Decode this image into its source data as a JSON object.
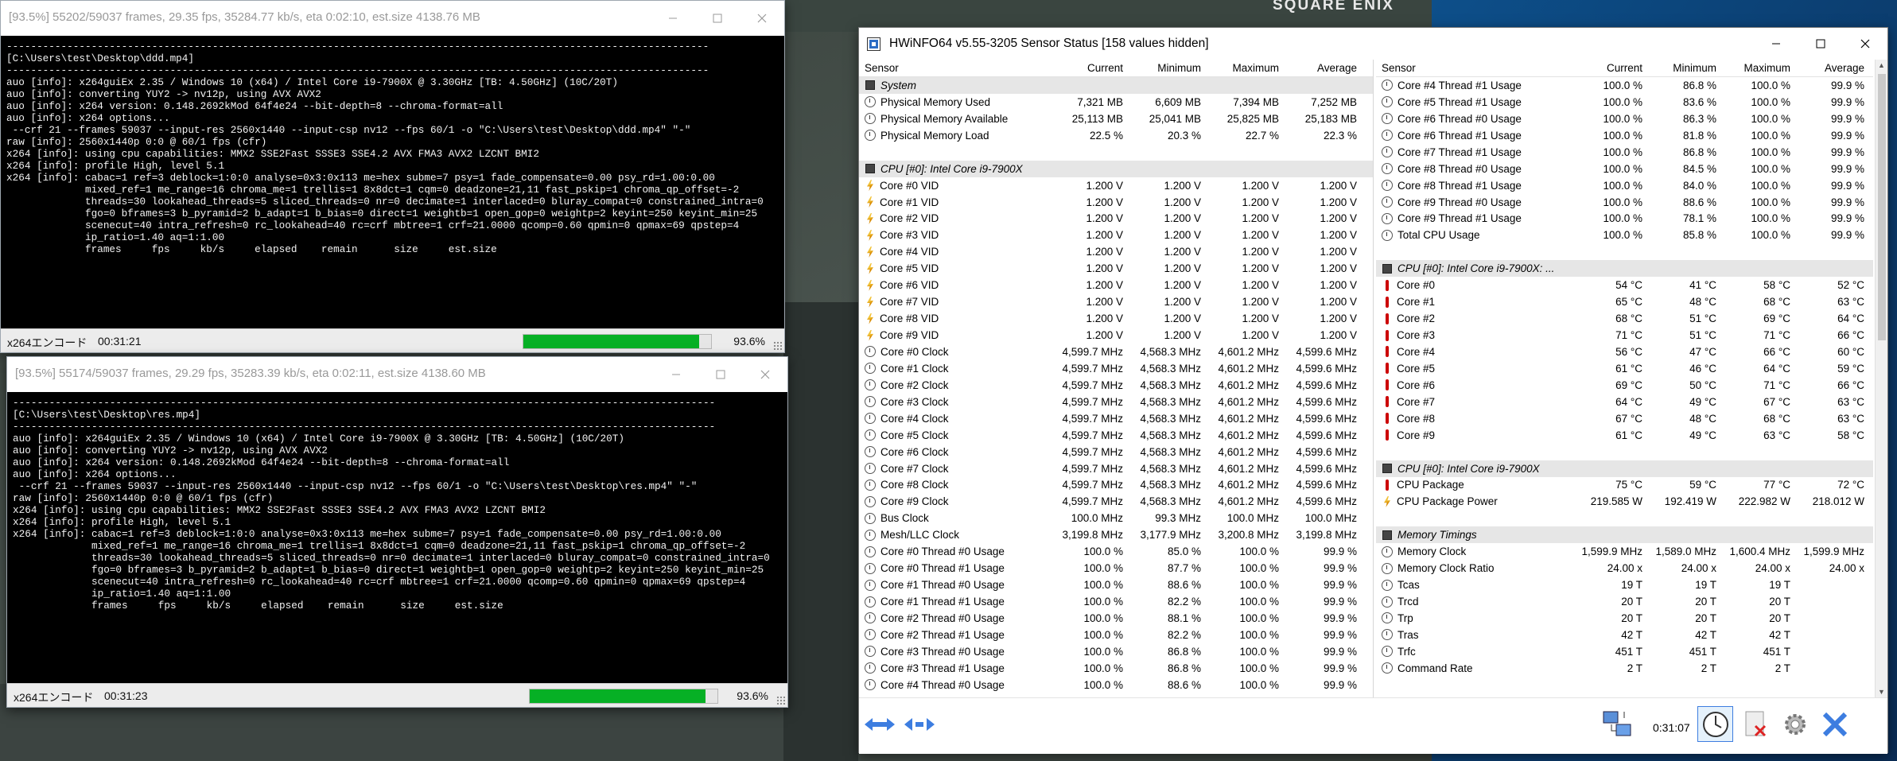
{
  "colors": {
    "accent_blue": "#3d7de0",
    "progress_green": "#06b025",
    "console_bg": "#000000",
    "thermo_red": "#cc0000"
  },
  "backdrop": {
    "brand_text": "SQUARE ENIX"
  },
  "encoder1": {
    "title": "[93.5%] 55202/59037 frames, 29.35 fps, 35284.77 kb/s, eta 0:02:10, est.size 4138.76 MB",
    "console_lines": [
      "--------------------------------------------------------------------------------------------------------------------",
      "[C:\\Users\\test\\Desktop\\ddd.mp4]",
      "--------------------------------------------------------------------------------------------------------------------",
      "auo [info]: x264guiEx 2.35 / Windows 10 (x64) / Intel Core i9-7900X @ 3.30GHz [TB: 4.50GHz] (10C/20T)",
      "auo [info]: converting YUY2 -> nv12p, using AVX AVX2",
      "auo [info]: x264 version: 0.148.2692kMod 64f4e24 --bit-depth=8 --chroma-format=all",
      "auo [info]: x264 options...",
      " --crf 21 --frames 59037 --input-res 2560x1440 --input-csp nv12 --fps 60/1 -o \"C:\\Users\\test\\Desktop\\ddd.mp4\" \"-\"",
      "raw [info]: 2560x1440p 0:0 @ 60/1 fps (cfr)",
      "x264 [info]: using cpu capabilities: MMX2 SSE2Fast SSSE3 SSE4.2 AVX FMA3 AVX2 LZCNT BMI2",
      "x264 [info]: profile High, level 5.1",
      "x264 [info]: cabac=1 ref=3 deblock=1:0:0 analyse=0x3:0x113 me=hex subme=7 psy=1 fade_compensate=0.00 psy_rd=1.00:0.00",
      "             mixed_ref=1 me_range=16 chroma_me=1 trellis=1 8x8dct=1 cqm=0 deadzone=21,11 fast_pskip=1 chroma_qp_offset=-2",
      "             threads=30 lookahead_threads=5 sliced_threads=0 nr=0 decimate=1 interlaced=0 bluray_compat=0 constrained_intra=0",
      "             fgo=0 bframes=3 b_pyramid=2 b_adapt=1 b_bias=0 direct=1 weightb=1 open_gop=0 weightp=2 keyint=250 keyint_min=25",
      "             scenecut=40 intra_refresh=0 rc_lookahead=40 rc=crf mbtree=1 crf=21.0000 qcomp=0.60 qpmin=0 qpmax=69 qpstep=4",
      "             ip_ratio=1.40 aq=1:1.00",
      "             frames     fps     kb/s     elapsed    remain      size     est.size"
    ],
    "status_tag": "x264エンコード",
    "elapsed": "00:31:21",
    "progress": 0.936,
    "percent": "93.6%"
  },
  "encoder2": {
    "title": "[93.5%] 55174/59037 frames, 29.29 fps, 35283.39 kb/s, eta 0:02:11, est.size 4138.60 MB",
    "console_lines": [
      "--------------------------------------------------------------------------------------------------------------------",
      "[C:\\Users\\test\\Desktop\\res.mp4]",
      "--------------------------------------------------------------------------------------------------------------------",
      "auo [info]: x264guiEx 2.35 / Windows 10 (x64) / Intel Core i9-7900X @ 3.30GHz [TB: 4.50GHz] (10C/20T)",
      "auo [info]: converting YUY2 -> nv12p, using AVX AVX2",
      "auo [info]: x264 version: 0.148.2692kMod 64f4e24 --bit-depth=8 --chroma-format=all",
      "auo [info]: x264 options...",
      " --crf 21 --frames 59037 --input-res 2560x1440 --input-csp nv12 --fps 60/1 -o \"C:\\Users\\test\\Desktop\\res.mp4\" \"-\"",
      "raw [info]: 2560x1440p 0:0 @ 60/1 fps (cfr)",
      "x264 [info]: using cpu capabilities: MMX2 SSE2Fast SSSE3 SSE4.2 AVX FMA3 AVX2 LZCNT BMI2",
      "x264 [info]: profile High, level 5.1",
      "x264 [info]: cabac=1 ref=3 deblock=1:0:0 analyse=0x3:0x113 me=hex subme=7 psy=1 fade_compensate=0.00 psy_rd=1.00:0.00",
      "             mixed_ref=1 me_range=16 chroma_me=1 trellis=1 8x8dct=1 cqm=0 deadzone=21,11 fast_pskip=1 chroma_qp_offset=-2",
      "             threads=30 lookahead_threads=5 sliced_threads=0 nr=0 decimate=1 interlaced=0 bluray_compat=0 constrained_intra=0",
      "             fgo=0 bframes=3 b_pyramid=2 b_adapt=1 b_bias=0 direct=1 weightb=1 open_gop=0 weightp=2 keyint=250 keyint_min=25",
      "             scenecut=40 intra_refresh=0 rc_lookahead=40 rc=crf mbtree=1 crf=21.0000 qcomp=0.60 qpmin=0 qpmax=69 qpstep=4",
      "             ip_ratio=1.40 aq=1:1.00",
      "             frames     fps     kb/s     elapsed    remain      size     est.size"
    ],
    "status_tag": "x264エンコード",
    "elapsed": "00:31:23",
    "progress": 0.936,
    "percent": "93.6%"
  },
  "hwinfo": {
    "title": "HWiNFO64 v5.55-3205 Sensor Status [158 values hidden]",
    "columns": [
      "Sensor",
      "Current",
      "Minimum",
      "Maximum",
      "Average"
    ],
    "left_rows": [
      {
        "kind": "cat",
        "label": "System"
      },
      {
        "kind": "clock",
        "label": "Physical Memory Used",
        "v": [
          "7,321 MB",
          "6,609 MB",
          "7,394 MB",
          "7,252 MB"
        ]
      },
      {
        "kind": "clock",
        "label": "Physical Memory Available",
        "v": [
          "25,113 MB",
          "25,041 MB",
          "25,825 MB",
          "25,183 MB"
        ]
      },
      {
        "kind": "clock",
        "label": "Physical Memory Load",
        "v": [
          "22.5 %",
          "20.3 %",
          "22.7 %",
          "22.3 %"
        ]
      },
      {
        "kind": "blank"
      },
      {
        "kind": "cat",
        "label": "CPU [#0]: Intel Core i9-7900X"
      },
      {
        "kind": "bolt",
        "label": "Core #0 VID",
        "v": [
          "1.200 V",
          "1.200 V",
          "1.200 V",
          "1.200 V"
        ]
      },
      {
        "kind": "bolt",
        "label": "Core #1 VID",
        "v": [
          "1.200 V",
          "1.200 V",
          "1.200 V",
          "1.200 V"
        ]
      },
      {
        "kind": "bolt",
        "label": "Core #2 VID",
        "v": [
          "1.200 V",
          "1.200 V",
          "1.200 V",
          "1.200 V"
        ]
      },
      {
        "kind": "bolt",
        "label": "Core #3 VID",
        "v": [
          "1.200 V",
          "1.200 V",
          "1.200 V",
          "1.200 V"
        ]
      },
      {
        "kind": "bolt",
        "label": "Core #4 VID",
        "v": [
          "1.200 V",
          "1.200 V",
          "1.200 V",
          "1.200 V"
        ]
      },
      {
        "kind": "bolt",
        "label": "Core #5 VID",
        "v": [
          "1.200 V",
          "1.200 V",
          "1.200 V",
          "1.200 V"
        ]
      },
      {
        "kind": "bolt",
        "label": "Core #6 VID",
        "v": [
          "1.200 V",
          "1.200 V",
          "1.200 V",
          "1.200 V"
        ]
      },
      {
        "kind": "bolt",
        "label": "Core #7 VID",
        "v": [
          "1.200 V",
          "1.200 V",
          "1.200 V",
          "1.200 V"
        ]
      },
      {
        "kind": "bolt",
        "label": "Core #8 VID",
        "v": [
          "1.200 V",
          "1.200 V",
          "1.200 V",
          "1.200 V"
        ]
      },
      {
        "kind": "bolt",
        "label": "Core #9 VID",
        "v": [
          "1.200 V",
          "1.200 V",
          "1.200 V",
          "1.200 V"
        ]
      },
      {
        "kind": "clock",
        "label": "Core #0 Clock",
        "v": [
          "4,599.7 MHz",
          "4,568.3 MHz",
          "4,601.2 MHz",
          "4,599.6 MHz"
        ]
      },
      {
        "kind": "clock",
        "label": "Core #1 Clock",
        "v": [
          "4,599.7 MHz",
          "4,568.3 MHz",
          "4,601.2 MHz",
          "4,599.6 MHz"
        ]
      },
      {
        "kind": "clock",
        "label": "Core #2 Clock",
        "v": [
          "4,599.7 MHz",
          "4,568.3 MHz",
          "4,601.2 MHz",
          "4,599.6 MHz"
        ]
      },
      {
        "kind": "clock",
        "label": "Core #3 Clock",
        "v": [
          "4,599.7 MHz",
          "4,568.3 MHz",
          "4,601.2 MHz",
          "4,599.6 MHz"
        ]
      },
      {
        "kind": "clock",
        "label": "Core #4 Clock",
        "v": [
          "4,599.7 MHz",
          "4,568.3 MHz",
          "4,601.2 MHz",
          "4,599.6 MHz"
        ]
      },
      {
        "kind": "clock",
        "label": "Core #5 Clock",
        "v": [
          "4,599.7 MHz",
          "4,568.3 MHz",
          "4,601.2 MHz",
          "4,599.6 MHz"
        ]
      },
      {
        "kind": "clock",
        "label": "Core #6 Clock",
        "v": [
          "4,599.7 MHz",
          "4,568.3 MHz",
          "4,601.2 MHz",
          "4,599.6 MHz"
        ]
      },
      {
        "kind": "clock",
        "label": "Core #7 Clock",
        "v": [
          "4,599.7 MHz",
          "4,568.3 MHz",
          "4,601.2 MHz",
          "4,599.6 MHz"
        ]
      },
      {
        "kind": "clock",
        "label": "Core #8 Clock",
        "v": [
          "4,599.7 MHz",
          "4,568.3 MHz",
          "4,601.2 MHz",
          "4,599.6 MHz"
        ]
      },
      {
        "kind": "clock",
        "label": "Core #9 Clock",
        "v": [
          "4,599.7 MHz",
          "4,568.3 MHz",
          "4,601.2 MHz",
          "4,599.6 MHz"
        ]
      },
      {
        "kind": "clock",
        "label": "Bus Clock",
        "v": [
          "100.0 MHz",
          "99.3 MHz",
          "100.0 MHz",
          "100.0 MHz"
        ]
      },
      {
        "kind": "clock",
        "label": "Mesh/LLC Clock",
        "v": [
          "3,199.8 MHz",
          "3,177.9 MHz",
          "3,200.8 MHz",
          "3,199.8 MHz"
        ]
      },
      {
        "kind": "clock",
        "label": "Core #0 Thread #0 Usage",
        "v": [
          "100.0 %",
          "85.0 %",
          "100.0 %",
          "99.9 %"
        ]
      },
      {
        "kind": "clock",
        "label": "Core #0 Thread #1 Usage",
        "v": [
          "100.0 %",
          "87.7 %",
          "100.0 %",
          "99.9 %"
        ]
      },
      {
        "kind": "clock",
        "label": "Core #1 Thread #0 Usage",
        "v": [
          "100.0 %",
          "88.6 %",
          "100.0 %",
          "99.9 %"
        ]
      },
      {
        "kind": "clock",
        "label": "Core #1 Thread #1 Usage",
        "v": [
          "100.0 %",
          "82.2 %",
          "100.0 %",
          "99.9 %"
        ]
      },
      {
        "kind": "clock",
        "label": "Core #2 Thread #0 Usage",
        "v": [
          "100.0 %",
          "88.1 %",
          "100.0 %",
          "99.9 %"
        ]
      },
      {
        "kind": "clock",
        "label": "Core #2 Thread #1 Usage",
        "v": [
          "100.0 %",
          "82.2 %",
          "100.0 %",
          "99.9 %"
        ]
      },
      {
        "kind": "clock",
        "label": "Core #3 Thread #0 Usage",
        "v": [
          "100.0 %",
          "86.8 %",
          "100.0 %",
          "99.9 %"
        ]
      },
      {
        "kind": "clock",
        "label": "Core #3 Thread #1 Usage",
        "v": [
          "100.0 %",
          "86.8 %",
          "100.0 %",
          "99.9 %"
        ]
      },
      {
        "kind": "clock",
        "label": "Core #4 Thread #0 Usage",
        "v": [
          "100.0 %",
          "88.6 %",
          "100.0 %",
          "99.9 %"
        ]
      }
    ],
    "right_rows": [
      {
        "kind": "clock",
        "label": "Core #4 Thread #1 Usage",
        "v": [
          "100.0 %",
          "86.8 %",
          "100.0 %",
          "99.9 %"
        ]
      },
      {
        "kind": "clock",
        "label": "Core #5 Thread #1 Usage",
        "v": [
          "100.0 %",
          "83.6 %",
          "100.0 %",
          "99.9 %"
        ]
      },
      {
        "kind": "clock",
        "label": "Core #6 Thread #0 Usage",
        "v": [
          "100.0 %",
          "86.3 %",
          "100.0 %",
          "99.9 %"
        ]
      },
      {
        "kind": "clock",
        "label": "Core #6 Thread #1 Usage",
        "v": [
          "100.0 %",
          "81.8 %",
          "100.0 %",
          "99.9 %"
        ]
      },
      {
        "kind": "clock",
        "label": "Core #7 Thread #1 Usage",
        "v": [
          "100.0 %",
          "86.8 %",
          "100.0 %",
          "99.9 %"
        ]
      },
      {
        "kind": "clock",
        "label": "Core #8 Thread #0 Usage",
        "v": [
          "100.0 %",
          "84.5 %",
          "100.0 %",
          "99.9 %"
        ]
      },
      {
        "kind": "clock",
        "label": "Core #8 Thread #1 Usage",
        "v": [
          "100.0 %",
          "84.0 %",
          "100.0 %",
          "99.9 %"
        ]
      },
      {
        "kind": "clock",
        "label": "Core #9 Thread #0 Usage",
        "v": [
          "100.0 %",
          "88.6 %",
          "100.0 %",
          "99.9 %"
        ]
      },
      {
        "kind": "clock",
        "label": "Core #9 Thread #1 Usage",
        "v": [
          "100.0 %",
          "78.1 %",
          "100.0 %",
          "99.9 %"
        ]
      },
      {
        "kind": "clock",
        "label": "Total CPU Usage",
        "v": [
          "100.0 %",
          "85.8 %",
          "100.0 %",
          "99.9 %"
        ]
      },
      {
        "kind": "blank"
      },
      {
        "kind": "cat",
        "label": "CPU [#0]: Intel Core i9-7900X: ..."
      },
      {
        "kind": "therm",
        "label": "Core #0",
        "v": [
          "54 °C",
          "41 °C",
          "58 °C",
          "52 °C"
        ]
      },
      {
        "kind": "therm",
        "label": "Core #1",
        "v": [
          "65 °C",
          "48 °C",
          "68 °C",
          "63 °C"
        ]
      },
      {
        "kind": "therm",
        "label": "Core #2",
        "v": [
          "68 °C",
          "51 °C",
          "69 °C",
          "64 °C"
        ]
      },
      {
        "kind": "therm",
        "label": "Core #3",
        "v": [
          "71 °C",
          "51 °C",
          "71 °C",
          "66 °C"
        ]
      },
      {
        "kind": "therm",
        "label": "Core #4",
        "v": [
          "56 °C",
          "47 °C",
          "66 °C",
          "60 °C"
        ]
      },
      {
        "kind": "therm",
        "label": "Core #5",
        "v": [
          "61 °C",
          "46 °C",
          "64 °C",
          "59 °C"
        ]
      },
      {
        "kind": "therm",
        "label": "Core #6",
        "v": [
          "69 °C",
          "50 °C",
          "71 °C",
          "66 °C"
        ]
      },
      {
        "kind": "therm",
        "label": "Core #7",
        "v": [
          "64 °C",
          "49 °C",
          "67 °C",
          "63 °C"
        ]
      },
      {
        "kind": "therm",
        "label": "Core #8",
        "v": [
          "67 °C",
          "48 °C",
          "68 °C",
          "63 °C"
        ]
      },
      {
        "kind": "therm",
        "label": "Core #9",
        "v": [
          "61 °C",
          "49 °C",
          "63 °C",
          "58 °C"
        ]
      },
      {
        "kind": "blank"
      },
      {
        "kind": "cat",
        "label": "CPU [#0]: Intel Core i9-7900X"
      },
      {
        "kind": "therm",
        "label": "CPU Package",
        "v": [
          "75 °C",
          "59 °C",
          "77 °C",
          "72 °C"
        ]
      },
      {
        "kind": "bolt",
        "label": "CPU Package Power",
        "v": [
          "219.585 W",
          "192.419 W",
          "222.982 W",
          "218.012 W"
        ]
      },
      {
        "kind": "blank"
      },
      {
        "kind": "cat",
        "label": "Memory Timings"
      },
      {
        "kind": "clock",
        "label": "Memory Clock",
        "v": [
          "1,599.9 MHz",
          "1,589.0 MHz",
          "1,600.4 MHz",
          "1,599.9 MHz"
        ]
      },
      {
        "kind": "clock",
        "label": "Memory Clock Ratio",
        "v": [
          "24.00 x",
          "24.00 x",
          "24.00 x",
          "24.00 x"
        ]
      },
      {
        "kind": "clock",
        "label": "Tcas",
        "v": [
          "19 T",
          "19 T",
          "19 T",
          ""
        ]
      },
      {
        "kind": "clock",
        "label": "Trcd",
        "v": [
          "20 T",
          "20 T",
          "20 T",
          ""
        ]
      },
      {
        "kind": "clock",
        "label": "Trp",
        "v": [
          "20 T",
          "20 T",
          "20 T",
          ""
        ]
      },
      {
        "kind": "clock",
        "label": "Tras",
        "v": [
          "42 T",
          "42 T",
          "42 T",
          ""
        ]
      },
      {
        "kind": "clock",
        "label": "Trfc",
        "v": [
          "451 T",
          "451 T",
          "451 T",
          ""
        ]
      },
      {
        "kind": "clock",
        "label": "Command Rate",
        "v": [
          "2 T",
          "2 T",
          "2 T",
          ""
        ]
      }
    ],
    "timer": "0:31:07",
    "buttons": [
      "expand-left-icon",
      "collapse-right-icon",
      "network-icon",
      "clock-icon",
      "clear-icon",
      "settings-icon",
      "close-icon"
    ]
  }
}
